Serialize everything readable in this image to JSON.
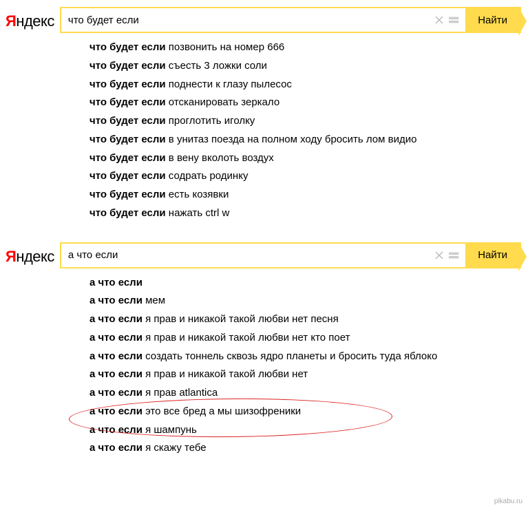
{
  "logo": {
    "red": "Я",
    "black": "ндекс"
  },
  "search_button": "Найти",
  "block1": {
    "query": "что будет если",
    "suggestions": [
      {
        "prefix": "что будет если",
        "completion": " позвонить на номер 666"
      },
      {
        "prefix": "что будет если",
        "completion": " съесть 3 ложки соли"
      },
      {
        "prefix": "что будет если",
        "completion": " поднести к глазу пылесос"
      },
      {
        "prefix": "что будет если",
        "completion": " отсканировать зеркало"
      },
      {
        "prefix": "что будет если",
        "completion": " проглотить иголку"
      },
      {
        "prefix": "что будет если",
        "completion": " в унитаз поезда на полном ходу бросить лом видио"
      },
      {
        "prefix": "что будет если",
        "completion": " в вену вколоть воздух"
      },
      {
        "prefix": "что будет если",
        "completion": " содрать родинку"
      },
      {
        "prefix": "что будет если",
        "completion": " есть козявки"
      },
      {
        "prefix": "что будет если",
        "completion": " нажать ctrl w"
      }
    ]
  },
  "block2": {
    "query": "а что если",
    "suggestions": [
      {
        "prefix": "а что если",
        "completion": ""
      },
      {
        "prefix": "а что если",
        "completion": " мем"
      },
      {
        "prefix": "а что если",
        "completion": " я прав и никакой такой любви нет песня"
      },
      {
        "prefix": "а что если",
        "completion": " я прав и никакой такой любви нет кто поет"
      },
      {
        "prefix": "а что если",
        "completion": " создать тоннель сквозь ядро планеты и бросить туда яблоко"
      },
      {
        "prefix": "а что если",
        "completion": " я прав и никакой такой любви нет"
      },
      {
        "prefix": "а что если",
        "completion": " я прав atlantica"
      },
      {
        "prefix": "а что если",
        "completion": " это все бред а мы шизофреники"
      },
      {
        "prefix": "а что если",
        "completion": " я шампунь"
      },
      {
        "prefix": "а что если",
        "completion": " я скажу тебе"
      }
    ]
  },
  "watermark": "pikabu.ru"
}
